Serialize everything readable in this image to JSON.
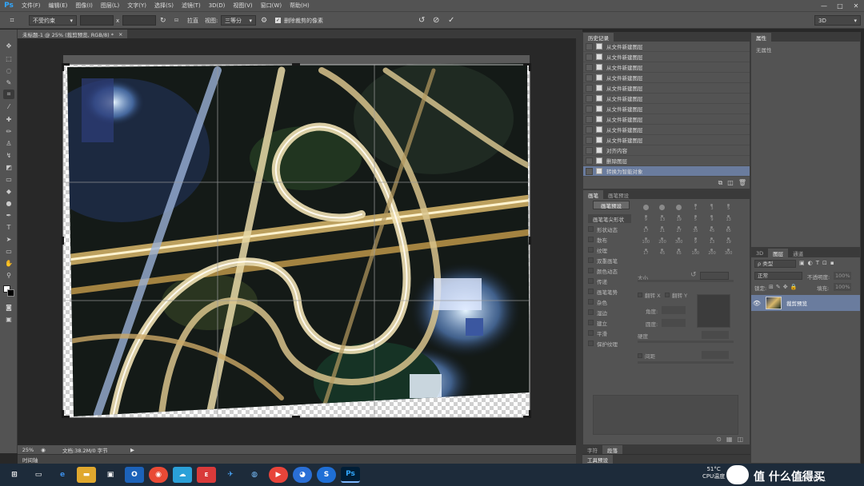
{
  "app": {
    "logo": "Ps"
  },
  "menu": [
    "文件(F)",
    "编辑(E)",
    "图像(I)",
    "图层(L)",
    "文字(Y)",
    "选择(S)",
    "滤镜(T)",
    "3D(D)",
    "视图(V)",
    "窗口(W)",
    "帮助(H)"
  ],
  "window_controls": {
    "minimize": "—",
    "maximize": "□",
    "close": "✕"
  },
  "options": {
    "ratio": "不受约束",
    "x_sep": "x",
    "straighten_label": "拉直",
    "view_label": "视图:",
    "view_value": "三等分",
    "delete_pixels_label": "删除裁剪的像素",
    "workspace": "3D"
  },
  "document": {
    "tab_title": "未标题-1 @ 25% (裁剪预览, RGB/8) *",
    "tab_close": "×",
    "zoom": "25%",
    "doc_info": "文档:38.2M/0 字节",
    "timeline": "时间轴"
  },
  "history": {
    "tab": "历史记录",
    "items": [
      "从文件新建图层",
      "从文件新建图层",
      "从文件新建图层",
      "从文件新建图层",
      "从文件新建图层",
      "从文件新建图层",
      "从文件新建图层",
      "从文件新建图层",
      "从文件新建图层",
      "从文件新建图层",
      "对齐内容",
      "删除图层",
      "转换为智能对象"
    ]
  },
  "brush": {
    "tabs": [
      "画笔",
      "画笔预设"
    ],
    "preset_button": "画笔预设",
    "tip_header": "画笔笔尖形状",
    "options": [
      "形状动态",
      "散布",
      "纹理",
      "双重画笔",
      "颜色动态",
      "传递",
      "画笔笔势",
      "杂色",
      "湿边",
      "建立",
      "平滑",
      "保护纹理"
    ],
    "size_label": "大小",
    "flip_x": "翻转 X",
    "flip_y": "翻转 Y",
    "angle_label": "角度:",
    "roundness_label": "圆度:",
    "hardness_label": "硬度",
    "spacing_label": "间距",
    "sizes": [
      "",
      "",
      "",
      "1",
      "3",
      "5",
      "9",
      "13",
      "19",
      "5",
      "9",
      "13",
      "17",
      "21",
      "27",
      "35",
      "45",
      "65",
      "100",
      "200",
      "300",
      "9",
      "13",
      "19",
      "17",
      "45",
      "65",
      "100",
      "200",
      "300"
    ]
  },
  "bottom_panels": {
    "char": "字符",
    "para": "段落",
    "tool_presets": "工具预设"
  },
  "properties": {
    "tab": "属性",
    "empty": "无属性"
  },
  "layers": {
    "tabs": [
      "3D",
      "图层",
      "通道"
    ],
    "filter_label": "ρ 类型",
    "blend_mode": "正常",
    "opacity_label": "不透明度:",
    "opacity": "100%",
    "lock_label": "锁定:",
    "fill_label": "填充:",
    "fill": "100%",
    "layer_name": "裁剪预览"
  },
  "taskbar": {
    "temp": "51°C",
    "cpu": "CPU温度",
    "date": "2016/10/11",
    "brand": "值 什么值得买"
  }
}
